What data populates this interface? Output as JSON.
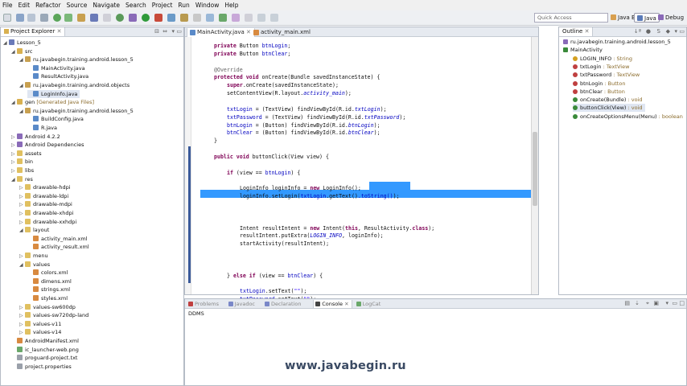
{
  "menu": [
    "File",
    "Edit",
    "Refactor",
    "Source",
    "Navigate",
    "Search",
    "Project",
    "Run",
    "Window",
    "Help"
  ],
  "toolbar": {
    "quick_access_placeholder": "Quick Access",
    "perspective_java_ee": "Java EE",
    "perspective_java": "Java",
    "perspective_debug": "Debug"
  },
  "project_explorer": {
    "title": "Project Explorer",
    "items": [
      {
        "label": "Lesson_5",
        "level": 0,
        "expanded": true,
        "icon": "project-icon"
      },
      {
        "label": "src",
        "level": 1,
        "expanded": true,
        "icon": "source-folder-icon"
      },
      {
        "label": "ru.javabegin.training.android.lesson_5",
        "level": 2,
        "expanded": true,
        "icon": "package-icon"
      },
      {
        "label": "MainActivity.java",
        "level": 3,
        "expanded": false,
        "icon": "java-file-icon"
      },
      {
        "label": "ResultActivity.java",
        "level": 3,
        "expanded": false,
        "icon": "java-file-icon"
      },
      {
        "label": "ru.javabegin.training.android.objects",
        "level": 2,
        "expanded": true,
        "icon": "package-icon"
      },
      {
        "label": "LoginInfo.java",
        "level": 3,
        "expanded": false,
        "icon": "java-file-icon",
        "selected": true
      },
      {
        "label": "gen",
        "decoration": "[Generated Java Files]",
        "level": 1,
        "expanded": true,
        "icon": "source-folder-icon"
      },
      {
        "label": "ru.javabegin.training.android.lesson_5",
        "level": 2,
        "expanded": true,
        "icon": "package-icon"
      },
      {
        "label": "BuildConfig.java",
        "level": 3,
        "expanded": false,
        "icon": "java-file-icon"
      },
      {
        "label": "R.java",
        "level": 3,
        "expanded": false,
        "icon": "java-file-icon"
      },
      {
        "label": "Android 4.2.2",
        "level": 1,
        "expanded": false,
        "icon": "library-icon"
      },
      {
        "label": "Android Dependencies",
        "level": 1,
        "expanded": false,
        "icon": "library-icon"
      },
      {
        "label": "assets",
        "level": 1,
        "expanded": false,
        "icon": "folder-icon"
      },
      {
        "label": "bin",
        "level": 1,
        "expanded": false,
        "icon": "folder-icon"
      },
      {
        "label": "libs",
        "level": 1,
        "expanded": false,
        "icon": "folder-icon"
      },
      {
        "label": "res",
        "level": 1,
        "expanded": true,
        "icon": "folder-icon"
      },
      {
        "label": "drawable-hdpi",
        "level": 2,
        "expanded": false,
        "icon": "folder-icon"
      },
      {
        "label": "drawable-ldpi",
        "level": 2,
        "expanded": false,
        "icon": "folder-icon"
      },
      {
        "label": "drawable-mdpi",
        "level": 2,
        "expanded": false,
        "icon": "folder-icon"
      },
      {
        "label": "drawable-xhdpi",
        "level": 2,
        "expanded": false,
        "icon": "folder-icon"
      },
      {
        "label": "drawable-xxhdpi",
        "level": 2,
        "expanded": false,
        "icon": "folder-icon"
      },
      {
        "label": "layout",
        "level": 2,
        "expanded": true,
        "icon": "folder-icon"
      },
      {
        "label": "activity_main.xml",
        "level": 3,
        "expanded": false,
        "icon": "xml-file-icon"
      },
      {
        "label": "activity_result.xml",
        "level": 3,
        "expanded": false,
        "icon": "xml-file-icon"
      },
      {
        "label": "menu",
        "level": 2,
        "expanded": false,
        "icon": "folder-icon"
      },
      {
        "label": "values",
        "level": 2,
        "expanded": true,
        "icon": "folder-icon"
      },
      {
        "label": "colors.xml",
        "level": 3,
        "expanded": false,
        "icon": "xml-file-icon"
      },
      {
        "label": "dimens.xml",
        "level": 3,
        "expanded": false,
        "icon": "xml-file-icon"
      },
      {
        "label": "strings.xml",
        "level": 3,
        "expanded": false,
        "icon": "xml-file-icon"
      },
      {
        "label": "styles.xml",
        "level": 3,
        "expanded": false,
        "icon": "xml-file-icon"
      },
      {
        "label": "values-sw600dp",
        "level": 2,
        "expanded": false,
        "icon": "folder-icon"
      },
      {
        "label": "values-sw720dp-land",
        "level": 2,
        "expanded": false,
        "icon": "folder-icon"
      },
      {
        "label": "values-v11",
        "level": 2,
        "expanded": false,
        "icon": "folder-icon"
      },
      {
        "label": "values-v14",
        "level": 2,
        "expanded": false,
        "icon": "folder-icon"
      },
      {
        "label": "AndroidManifest.xml",
        "level": 1,
        "expanded": false,
        "icon": "xml-file-icon"
      },
      {
        "label": "ic_launcher-web.png",
        "level": 1,
        "expanded": false,
        "icon": "image-file-icon"
      },
      {
        "label": "proguard-project.txt",
        "level": 1,
        "expanded": false,
        "icon": "text-file-icon"
      },
      {
        "label": "project.properties",
        "level": 1,
        "expanded": false,
        "icon": "text-file-icon"
      }
    ]
  },
  "editor": {
    "tabs": [
      {
        "label": "MainActivity.java",
        "active": true
      },
      {
        "label": "activity_main.xml",
        "active": false
      }
    ],
    "lines": [
      {
        "indent": 2,
        "tokens": [
          [
            "kw",
            "private "
          ],
          [
            "",
            "Button "
          ],
          [
            "fld",
            "btnLogin"
          ],
          [
            "",
            ";"
          ]
        ]
      },
      {
        "indent": 2,
        "tokens": [
          [
            "kw",
            "private "
          ],
          [
            "",
            "Button "
          ],
          [
            "fld",
            "btnClear"
          ],
          [
            "",
            ";"
          ]
        ]
      },
      {
        "indent": 0,
        "tokens": []
      },
      {
        "indent": 2,
        "tokens": [
          [
            "ann",
            "@Override"
          ]
        ]
      },
      {
        "indent": 2,
        "tokens": [
          [
            "kw",
            "protected void "
          ],
          [
            "",
            "onCreate(Bundle savedInstanceState) {"
          ]
        ]
      },
      {
        "indent": 4,
        "tokens": [
          [
            "kw",
            "super"
          ],
          [
            "",
            ".onCreate(savedInstanceState);"
          ]
        ]
      },
      {
        "indent": 4,
        "tokens": [
          [
            "",
            "setContentView(R.layout."
          ],
          [
            "itl",
            "activity_main"
          ],
          [
            "",
            ");"
          ]
        ]
      },
      {
        "indent": 0,
        "tokens": []
      },
      {
        "indent": 4,
        "tokens": [
          [
            "fld",
            "txtLogin"
          ],
          [
            "",
            " = (TextView) findViewById(R.id."
          ],
          [
            "itl",
            "txtLogin"
          ],
          [
            "",
            ");"
          ]
        ]
      },
      {
        "indent": 4,
        "tokens": [
          [
            "fld",
            "txtPassword"
          ],
          [
            "",
            " = (TextView) findViewById(R.id."
          ],
          [
            "itl",
            "txtPassword"
          ],
          [
            "",
            ");"
          ]
        ]
      },
      {
        "indent": 4,
        "tokens": [
          [
            "fld",
            "btnLogin"
          ],
          [
            "",
            " = (Button) findViewById(R.id."
          ],
          [
            "itl",
            "btnLogin"
          ],
          [
            "",
            ");"
          ]
        ]
      },
      {
        "indent": 4,
        "tokens": [
          [
            "fld",
            "btnClear"
          ],
          [
            "",
            " = (Button) findViewById(R.id."
          ],
          [
            "itl",
            "btnClear"
          ],
          [
            "",
            ");"
          ]
        ]
      },
      {
        "indent": 2,
        "tokens": [
          [
            "",
            "}"
          ]
        ]
      },
      {
        "indent": 0,
        "tokens": []
      },
      {
        "indent": 2,
        "tokens": [
          [
            "kw",
            "public void "
          ],
          [
            "",
            "buttonClick(View view) {"
          ]
        ]
      },
      {
        "indent": 0,
        "tokens": []
      },
      {
        "indent": 4,
        "tokens": [
          [
            "kw",
            "if "
          ],
          [
            "",
            "(view == "
          ],
          [
            "fld",
            "btnLogin"
          ],
          [
            "",
            ") {"
          ]
        ]
      },
      {
        "indent": 0,
        "tokens": []
      },
      {
        "indent": 6,
        "tokens": [
          [
            "",
            "LoginInfo loginInfo = "
          ],
          [
            "kw",
            "new "
          ],
          [
            "",
            "LoginInfo();"
          ]
        ]
      },
      {
        "indent": 6,
        "tokens": [
          [
            "",
            "loginInfo.setLogin("
          ],
          [
            "fld",
            "txtLogin"
          ],
          [
            "",
            ".getText()"
          ],
          [
            "fld",
            ".toString()"
          ],
          [
            "",
            ");"
          ]
        ]
      },
      {
        "indent": 6,
        "tokens": [
          [
            "",
            "loginInfo.setPassword("
          ],
          [
            "fld",
            "txtPassword"
          ],
          [
            "",
            ".getText().toString());"
          ]
        ],
        "selected": true
      },
      {
        "indent": 0,
        "tokens": []
      },
      {
        "indent": 0,
        "tokens": []
      },
      {
        "indent": 6,
        "tokens": [
          [
            "",
            "Intent resultIntent = "
          ],
          [
            "kw",
            "new "
          ],
          [
            "",
            "Intent("
          ],
          [
            "kw",
            "this"
          ],
          [
            "",
            ", ResultActivity."
          ],
          [
            "kw",
            "class"
          ],
          [
            "",
            ");"
          ]
        ]
      },
      {
        "indent": 6,
        "tokens": [
          [
            "",
            "resultIntent.putExtra("
          ],
          [
            "itl",
            "LOGIN_INFO"
          ],
          [
            "",
            ", loginInfo);"
          ]
        ]
      },
      {
        "indent": 6,
        "tokens": [
          [
            "",
            "startActivity(resultIntent);"
          ]
        ]
      },
      {
        "indent": 0,
        "tokens": []
      },
      {
        "indent": 0,
        "tokens": []
      },
      {
        "indent": 0,
        "tokens": []
      },
      {
        "indent": 4,
        "tokens": [
          [
            "",
            "} "
          ],
          [
            "kw",
            "else if "
          ],
          [
            "",
            "(view == "
          ],
          [
            "fld",
            "btnClear"
          ],
          [
            "",
            ") {"
          ]
        ]
      },
      {
        "indent": 0,
        "tokens": []
      },
      {
        "indent": 6,
        "tokens": [
          [
            "fld",
            "txtLogin"
          ],
          [
            "",
            ".setText("
          ],
          [
            "str",
            "\"\""
          ],
          [
            "",
            ");"
          ]
        ]
      },
      {
        "indent": 6,
        "tokens": [
          [
            "fld",
            "txtPassword"
          ],
          [
            "",
            ".setText("
          ],
          [
            "str",
            "\"\""
          ],
          [
            "",
            ");"
          ]
        ]
      }
    ]
  },
  "outline": {
    "title": "Outline",
    "items": [
      {
        "label": "ru.javabegin.training.android.lesson_5",
        "type": "",
        "level": 0,
        "icon": "package-icon",
        "color": "#8a6bb8"
      },
      {
        "label": "MainActivity",
        "type": "",
        "level": 0,
        "icon": "class-icon",
        "color": "#3a8a3a"
      },
      {
        "label": "LOGIN_INFO",
        "type": ": String",
        "level": 1,
        "icon": "field-icon",
        "color": "#d4a020"
      },
      {
        "label": "txtLogin",
        "type": ": TextView",
        "level": 1,
        "icon": "field-icon",
        "color": "#c04040"
      },
      {
        "label": "txtPassword",
        "type": ": TextView",
        "level": 1,
        "icon": "field-icon",
        "color": "#c04040"
      },
      {
        "label": "btnLogin",
        "type": ": Button",
        "level": 1,
        "icon": "field-icon",
        "color": "#c04040"
      },
      {
        "label": "btnClear",
        "type": ": Button",
        "level": 1,
        "icon": "field-icon",
        "color": "#c04040"
      },
      {
        "label": "onCreate(Bundle)",
        "type": ": void",
        "level": 1,
        "icon": "method-icon",
        "color": "#3a8a3a"
      },
      {
        "label": "buttonClick(View)",
        "type": ": void",
        "level": 1,
        "icon": "method-icon",
        "color": "#3a8a3a",
        "selected": true
      },
      {
        "label": "onCreateOptionsMenu(Menu)",
        "type": ": boolean",
        "level": 1,
        "icon": "method-icon",
        "color": "#3a8a3a"
      }
    ]
  },
  "bottom": {
    "tabs": [
      {
        "label": "Problems",
        "active": false,
        "color": "#c04040"
      },
      {
        "label": "Javadoc",
        "active": false,
        "color": "#7a88c8"
      },
      {
        "label": "Declaration",
        "active": false,
        "color": "#7a88c8"
      },
      {
        "label": "Console",
        "active": true,
        "color": "#444444"
      },
      {
        "label": "LogCat",
        "active": false,
        "color": "#6aa86a"
      }
    ],
    "console_header": "DDMS"
  },
  "watermark": "www.javabegin.ru"
}
